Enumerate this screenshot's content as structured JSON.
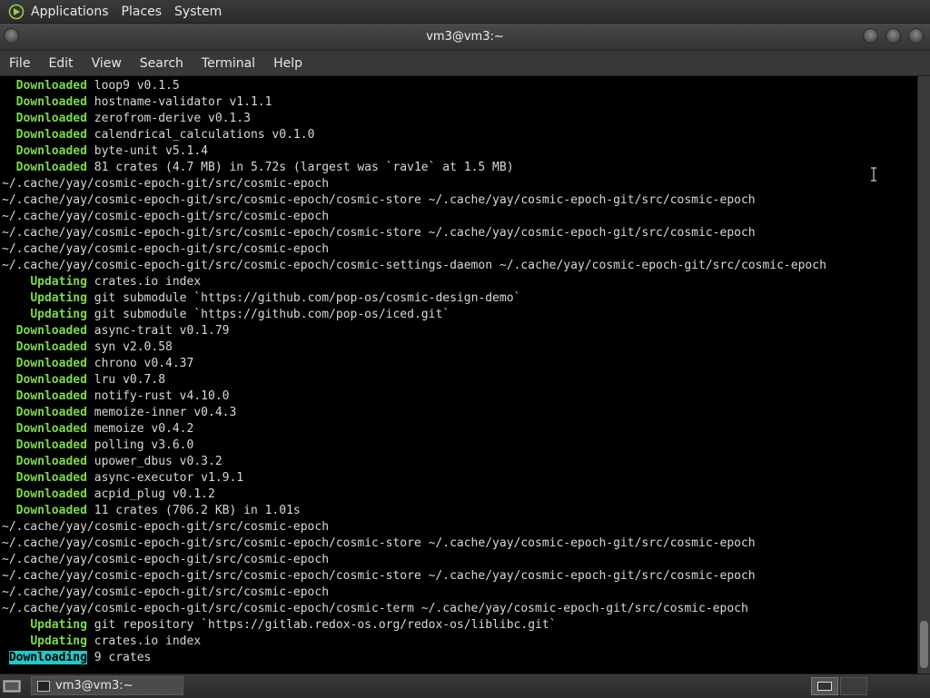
{
  "top_panel": {
    "menus": [
      "Applications",
      "Places",
      "System"
    ]
  },
  "window": {
    "title": "vm3@vm3:~"
  },
  "menubar": {
    "items": [
      "File",
      "Edit",
      "View",
      "Search",
      "Terminal",
      "Help"
    ]
  },
  "terminal": {
    "lines": [
      {
        "indent": "  ",
        "kw": "Downloaded",
        "text": " loop9 v0.1.5"
      },
      {
        "indent": "  ",
        "kw": "Downloaded",
        "text": " hostname-validator v1.1.1"
      },
      {
        "indent": "  ",
        "kw": "Downloaded",
        "text": " zerofrom-derive v0.1.3"
      },
      {
        "indent": "  ",
        "kw": "Downloaded",
        "text": " calendrical_calculations v0.1.0"
      },
      {
        "indent": "  ",
        "kw": "Downloaded",
        "text": " byte-unit v5.1.4"
      },
      {
        "indent": "  ",
        "kw": "Downloaded",
        "text": " 81 crates (4.7 MB) in 5.72s (largest was `rav1e` at 1.5 MB)"
      },
      {
        "indent": "",
        "kw": "",
        "text": "~/.cache/yay/cosmic-epoch-git/src/cosmic-epoch"
      },
      {
        "indent": "",
        "kw": "",
        "text": "~/.cache/yay/cosmic-epoch-git/src/cosmic-epoch/cosmic-store ~/.cache/yay/cosmic-epoch-git/src/cosmic-epoch"
      },
      {
        "indent": "",
        "kw": "",
        "text": "~/.cache/yay/cosmic-epoch-git/src/cosmic-epoch"
      },
      {
        "indent": "",
        "kw": "",
        "text": "~/.cache/yay/cosmic-epoch-git/src/cosmic-epoch/cosmic-store ~/.cache/yay/cosmic-epoch-git/src/cosmic-epoch"
      },
      {
        "indent": "",
        "kw": "",
        "text": "~/.cache/yay/cosmic-epoch-git/src/cosmic-epoch"
      },
      {
        "indent": "",
        "kw": "",
        "text": "~/.cache/yay/cosmic-epoch-git/src/cosmic-epoch/cosmic-settings-daemon ~/.cache/yay/cosmic-epoch-git/src/cosmic-epoch"
      },
      {
        "indent": "    ",
        "kw": "Updating",
        "text": " crates.io index"
      },
      {
        "indent": "    ",
        "kw": "Updating",
        "text": " git submodule `https://github.com/pop-os/cosmic-design-demo`"
      },
      {
        "indent": "    ",
        "kw": "Updating",
        "text": " git submodule `https://github.com/pop-os/iced.git`"
      },
      {
        "indent": "  ",
        "kw": "Downloaded",
        "text": " async-trait v0.1.79"
      },
      {
        "indent": "  ",
        "kw": "Downloaded",
        "text": " syn v2.0.58"
      },
      {
        "indent": "  ",
        "kw": "Downloaded",
        "text": " chrono v0.4.37"
      },
      {
        "indent": "  ",
        "kw": "Downloaded",
        "text": " lru v0.7.8"
      },
      {
        "indent": "  ",
        "kw": "Downloaded",
        "text": " notify-rust v4.10.0"
      },
      {
        "indent": "  ",
        "kw": "Downloaded",
        "text": " memoize-inner v0.4.3"
      },
      {
        "indent": "  ",
        "kw": "Downloaded",
        "text": " memoize v0.4.2"
      },
      {
        "indent": "  ",
        "kw": "Downloaded",
        "text": " polling v3.6.0"
      },
      {
        "indent": "  ",
        "kw": "Downloaded",
        "text": " upower_dbus v0.3.2"
      },
      {
        "indent": "  ",
        "kw": "Downloaded",
        "text": " async-executor v1.9.1"
      },
      {
        "indent": "  ",
        "kw": "Downloaded",
        "text": " acpid_plug v0.1.2"
      },
      {
        "indent": "  ",
        "kw": "Downloaded",
        "text": " 11 crates (706.2 KB) in 1.01s"
      },
      {
        "indent": "",
        "kw": "",
        "text": "~/.cache/yay/cosmic-epoch-git/src/cosmic-epoch"
      },
      {
        "indent": "",
        "kw": "",
        "text": "~/.cache/yay/cosmic-epoch-git/src/cosmic-epoch/cosmic-store ~/.cache/yay/cosmic-epoch-git/src/cosmic-epoch"
      },
      {
        "indent": "",
        "kw": "",
        "text": "~/.cache/yay/cosmic-epoch-git/src/cosmic-epoch"
      },
      {
        "indent": "",
        "kw": "",
        "text": "~/.cache/yay/cosmic-epoch-git/src/cosmic-epoch/cosmic-store ~/.cache/yay/cosmic-epoch-git/src/cosmic-epoch"
      },
      {
        "indent": "",
        "kw": "",
        "text": "~/.cache/yay/cosmic-epoch-git/src/cosmic-epoch"
      },
      {
        "indent": "",
        "kw": "",
        "text": "~/.cache/yay/cosmic-epoch-git/src/cosmic-epoch/cosmic-term ~/.cache/yay/cosmic-epoch-git/src/cosmic-epoch"
      },
      {
        "indent": "    ",
        "kw": "Updating",
        "text": " git repository `https://gitlab.redox-os.org/redox-os/liblibc.git`"
      },
      {
        "indent": "    ",
        "kw": "Updating",
        "text": " crates.io index"
      },
      {
        "indent": " ",
        "kw": "Downloading",
        "text": " 9 crates",
        "active": true
      }
    ]
  },
  "taskbar": {
    "task_label": "vm3@vm3:~"
  },
  "colors": {
    "keyword": "#7fd84a",
    "progress_highlight": "#22c7c7",
    "terminal_bg": "#000000"
  }
}
